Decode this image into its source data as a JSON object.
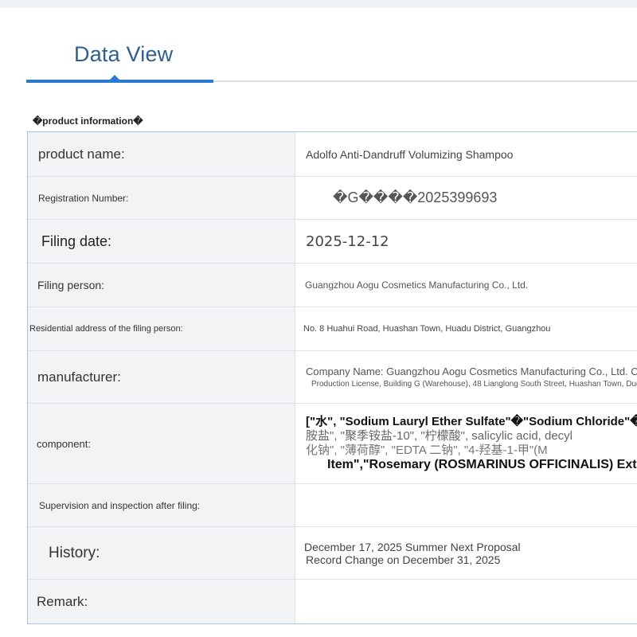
{
  "tabs": {
    "active_label": "Data View"
  },
  "section": {
    "title": "�product information�"
  },
  "rows": {
    "product_name": {
      "label": "product name:",
      "value": "Adolfo Anti-Dandruff Volumizing Shampoo"
    },
    "registration_number": {
      "label": "Registration Number:",
      "value": "�G����2025399693"
    },
    "filing_date": {
      "label": "Filing date:",
      "value": "2025-12-12"
    },
    "filing_person": {
      "label": "Filing person:",
      "value": "Guangzhou Aogu Cosmetics Manufacturing Co., Ltd."
    },
    "residential_address": {
      "label": "Residential address of the filing person:",
      "value": "No. 8 Huahui Road, Huashan Town, Huadu District, Guangzhou"
    },
    "manufacturer": {
      "label": "manufacturer:",
      "value_line1": "Company Name: Guangzhou Aogu Cosmetics Manufacturing Co., Ltd. Company Address:",
      "value_line2": "Production License, Building G (Warehouse), 48 Lianglong South Street, Huashan Town, Dudistrict, City"
    },
    "component": {
      "label": "component:",
      "lines": [
        "[\"水\",  \"Sodium Lauryl Ether Sulfate\"�\"Sodium Chloride\"�\"Guar Gum\"",
        "胺盐\", \"聚季铵盐-10\", \"柠檬酸\", salicylic acid, decyl",
        "化钠\", \"薄荷醇\", \"EDTA 二钠\", \"4-羟基-1-甲\"(M",
        "Item\",\"Rosemary (ROSMARINUS OFFICINALIS) Extract"
      ]
    },
    "supervision": {
      "label": "Supervision and inspection after filing:",
      "value": ""
    },
    "history": {
      "label": "History:",
      "value_line1": "December 17, 2025 Summer Next Proposal",
      "value_line2": "Record Change on December 31, 2025"
    },
    "remark": {
      "label": "Remark:",
      "value": ""
    }
  }
}
